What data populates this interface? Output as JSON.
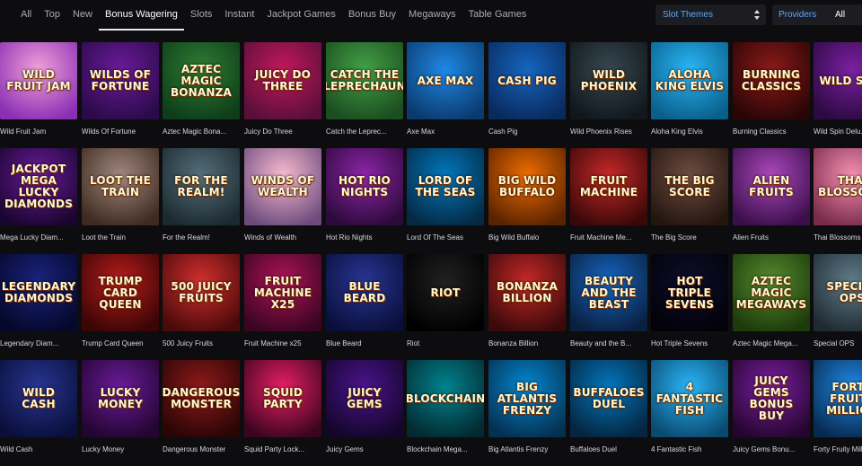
{
  "tabs": [
    {
      "label": "All",
      "active": false
    },
    {
      "label": "Top",
      "active": false
    },
    {
      "label": "New",
      "active": false
    },
    {
      "label": "Bonus Wagering",
      "active": true
    },
    {
      "label": "Slots",
      "active": false
    },
    {
      "label": "Instant",
      "active": false
    },
    {
      "label": "Jackpot Games",
      "active": false
    },
    {
      "label": "Bonus Buy",
      "active": false
    },
    {
      "label": "Megaways",
      "active": false
    },
    {
      "label": "Table Games",
      "active": false
    }
  ],
  "filters": {
    "slot_themes_label": "Slot Themes",
    "providers_label": "Providers",
    "providers_value": "All"
  },
  "rows": [
    [
      {
        "name": "Wild Fruit Jam",
        "art": "WILD FRUIT JAM",
        "c1": "#f2a0d8",
        "c2": "#8a2fb5"
      },
      {
        "name": "Wilds Of Fortune",
        "art": "WILDS OF FORTUNE",
        "c1": "#6a1b9a",
        "c2": "#2b0a4a"
      },
      {
        "name": "Aztec Magic Bona...",
        "art": "AZTEC MAGIC BONANZA",
        "c1": "#2e7d32",
        "c2": "#0f3d1a"
      },
      {
        "name": "Juicy Do Three",
        "art": "JUICY DO THREE",
        "c1": "#c2185b",
        "c2": "#5a0f3a"
      },
      {
        "name": "Catch the Leprec...",
        "art": "CATCH THE LEPRECHAUN",
        "c1": "#43a047",
        "c2": "#1b4d1f"
      },
      {
        "name": "Axe Max",
        "art": "AXE MAX",
        "c1": "#1e88e5",
        "c2": "#0b3a6e"
      },
      {
        "name": "Cash Pig",
        "art": "CASH PIG",
        "c1": "#1565c0",
        "c2": "#0a2a5c"
      },
      {
        "name": "Wild Phoenix Rises",
        "art": "WILD PHOENIX",
        "c1": "#37474f",
        "c2": "#10181c"
      },
      {
        "name": "Aloha King Elvis",
        "art": "ALOHA KING ELVIS",
        "c1": "#29b6f6",
        "c2": "#0a5f8a"
      },
      {
        "name": "Burning Classics",
        "art": "BURNING CLASSICS",
        "c1": "#8b1a1a",
        "c2": "#2a0505"
      },
      {
        "name": "Wild Spin Delu...",
        "art": "WILD SPIN",
        "c1": "#7b1fa2",
        "c2": "#2a0a40"
      }
    ],
    [
      {
        "name": "Mega Lucky Diam...",
        "art": "JACKPOT MEGA LUCKY DIAMONDS",
        "c1": "#6a1b9a",
        "c2": "#1a0530"
      },
      {
        "name": "Loot the Train",
        "art": "LOOT THE TRAIN",
        "c1": "#a1887f",
        "c2": "#3e2a20"
      },
      {
        "name": "For the Realm!",
        "art": "FOR THE REALM!",
        "c1": "#546e7a",
        "c2": "#1c2a30"
      },
      {
        "name": "Winds of Wealth",
        "art": "WINDS OF WEALTH",
        "c1": "#f8bbd0",
        "c2": "#6d4c7d"
      },
      {
        "name": "Hot Rio Nights",
        "art": "HOT RIO NIGHTS",
        "c1": "#8e24aa",
        "c2": "#2c0a3a"
      },
      {
        "name": "Lord Of The Seas",
        "art": "LORD OF THE SEAS",
        "c1": "#0277bd",
        "c2": "#042a44"
      },
      {
        "name": "Big Wild Buffalo",
        "art": "BIG WILD BUFFALO",
        "c1": "#ef6c00",
        "c2": "#5a2300"
      },
      {
        "name": "Fruit Machine Me...",
        "art": "FRUIT MACHINE",
        "c1": "#c62828",
        "c2": "#3a0808"
      },
      {
        "name": "The Big Score",
        "art": "THE BIG SCORE",
        "c1": "#6d4c41",
        "c2": "#24160f"
      },
      {
        "name": "Alien Fruits",
        "art": "ALIEN FRUITS",
        "c1": "#ab47bc",
        "c2": "#3a0f4a"
      },
      {
        "name": "Thai Blossoms",
        "art": "THAI BLOSSOMS",
        "c1": "#f48fb1",
        "c2": "#7a2a4a"
      }
    ],
    [
      {
        "name": "Legendary Diam...",
        "art": "LEGENDARY DIAMONDS",
        "c1": "#1a237e",
        "c2": "#05082a"
      },
      {
        "name": "Trump Card Queen",
        "art": "TRUMP CARD QUEEN",
        "c1": "#b71c1c",
        "c2": "#3a0505"
      },
      {
        "name": "500 Juicy Fruits",
        "art": "500 JUICY FRUITS",
        "c1": "#d32f2f",
        "c2": "#4a0a0a"
      },
      {
        "name": "Fruit Machine x25",
        "art": "FRUIT MACHINE X25",
        "c1": "#ad1457",
        "c2": "#3a0522"
      },
      {
        "name": "Blue Beard",
        "art": "BLUE BEARD",
        "c1": "#283593",
        "c2": "#0a0f3a"
      },
      {
        "name": "Riot",
        "art": "RIOT",
        "c1": "#212121",
        "c2": "#000000"
      },
      {
        "name": "Bonanza Billion",
        "art": "BONANZA BILLION",
        "c1": "#c62828",
        "c2": "#3a0a0a"
      },
      {
        "name": "Beauty and the B...",
        "art": "BEAUTY AND THE BEAST",
        "c1": "#1565c0",
        "c2": "#0a2040"
      },
      {
        "name": "Hot Triple Sevens",
        "art": "HOT TRIPLE SEVENS",
        "c1": "#0d0d2a",
        "c2": "#02020a"
      },
      {
        "name": "Aztec Magic Mega...",
        "art": "AZTEC MAGIC MEGAWAYS",
        "c1": "#558b2f",
        "c2": "#1c3a0a"
      },
      {
        "name": "Special OPS",
        "art": "SPECIAL OPS",
        "c1": "#607d8b",
        "c2": "#1f2a30"
      }
    ],
    [
      {
        "name": "Wild Cash",
        "art": "WILD CASH",
        "c1": "#283593",
        "c2": "#0a0f3a"
      },
      {
        "name": "Lucky Money",
        "art": "LUCKY MONEY",
        "c1": "#6a1b9a",
        "c2": "#220530"
      },
      {
        "name": "Dangerous Monster",
        "art": "DANGEROUS MONSTER",
        "c1": "#8d1a1a",
        "c2": "#2a0505"
      },
      {
        "name": "Squid Party Lock...",
        "art": "SQUID PARTY",
        "c1": "#e91e63",
        "c2": "#3a0520"
      },
      {
        "name": "Juicy Gems",
        "art": "JUICY GEMS",
        "c1": "#4a148c",
        "c2": "#14052a"
      },
      {
        "name": "Blockchain Mega...",
        "art": "BLOCKCHAIN",
        "c1": "#00838f",
        "c2": "#032a30"
      },
      {
        "name": "Big Atlantis Frenzy",
        "art": "BIG ATLANTIS FRENZY",
        "c1": "#0288d1",
        "c2": "#053050"
      },
      {
        "name": "Buffaloes Duel",
        "art": "BUFFALOES DUEL",
        "c1": "#0277bd",
        "c2": "#052540"
      },
      {
        "name": "4 Fantastic Fish",
        "art": "4 FANTASTIC FISH",
        "c1": "#29b6f6",
        "c2": "#0a4a70"
      },
      {
        "name": "Juicy Gems Bonu...",
        "art": "JUICY GEMS BONUS BUY",
        "c1": "#7b1fa2",
        "c2": "#25052f"
      },
      {
        "name": "Forty Fruity Milli...",
        "art": "FORTY FRUITY MILLION",
        "c1": "#1e88e5",
        "c2": "#082a50"
      }
    ]
  ]
}
